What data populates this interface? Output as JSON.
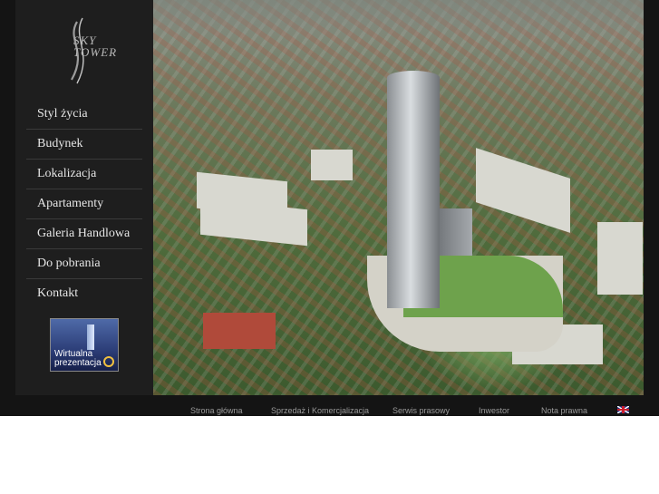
{
  "brand": {
    "logo_line1": "SKY",
    "logo_line2": "TOWER"
  },
  "menu": [
    "Styl życia",
    "Budynek",
    "Lokalizacja",
    "Apartamenty",
    "Galeria Handlowa",
    "Do pobrania",
    "Kontakt"
  ],
  "virtual_tour": {
    "line1": "Wirtualna",
    "line2": "prezentacja"
  },
  "footer": {
    "links": [
      "Strona główna",
      "Sprzedaż i Komercjalizacja",
      "Serwis prasowy",
      "Inwestor",
      "Nota prawna"
    ],
    "language_icon": "uk-flag-icon"
  },
  "colors": {
    "sidebar": "#1e1e1e",
    "background": "#141414",
    "menu_text": "#e6e6e6",
    "footer_text": "#9a9a9a"
  }
}
